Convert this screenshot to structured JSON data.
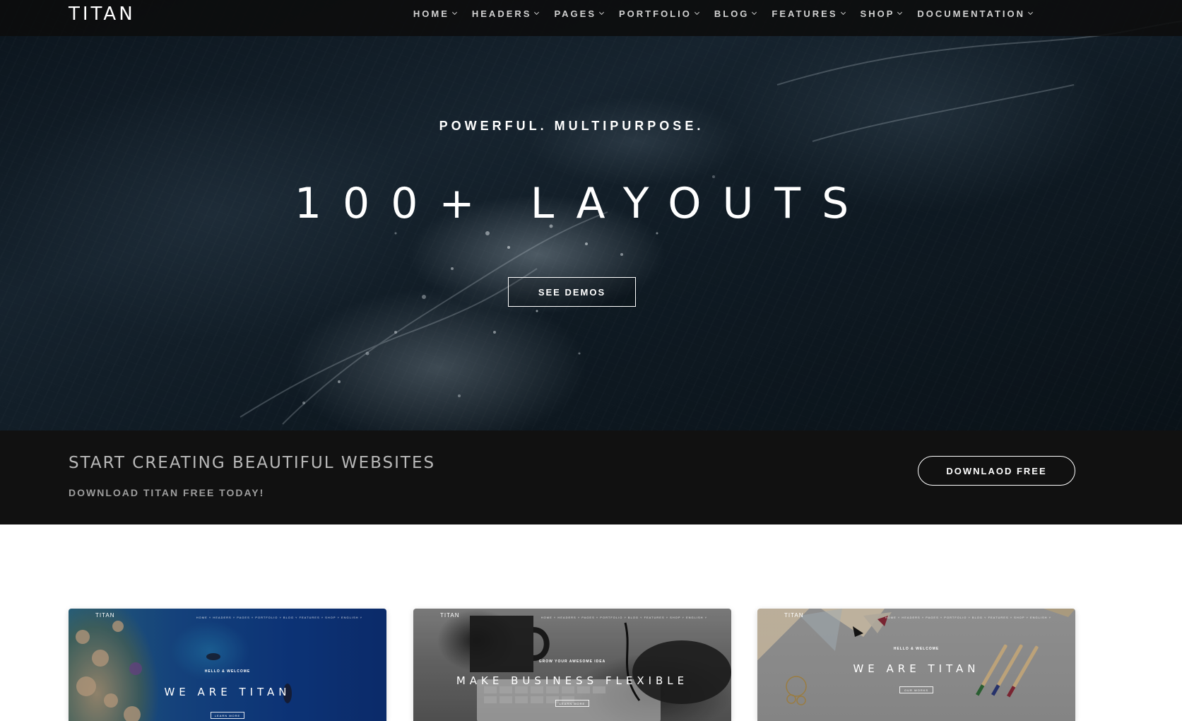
{
  "brand": {
    "name": "TITAN"
  },
  "nav": {
    "items": [
      {
        "label": "HOME"
      },
      {
        "label": "HEADERS"
      },
      {
        "label": "PAGES"
      },
      {
        "label": "PORTFOLIO"
      },
      {
        "label": "BLOG"
      },
      {
        "label": "FEATURES"
      },
      {
        "label": "SHOP"
      },
      {
        "label": "DOCUMENTATION"
      }
    ]
  },
  "hero": {
    "subtitle": "POWERFUL. MULTIPURPOSE.",
    "title": "100+ LAYOUTS",
    "button_label": "SEE DEMOS"
  },
  "cta": {
    "title": "START CREATING BEAUTIFUL WEBSITES",
    "subtitle": "DOWNLOAD TITAN FREE TODAY!",
    "button_label": "DOWNLAOD FREE"
  },
  "demos": [
    {
      "logo": "TITAN",
      "nav": "HOME ˅  HEADERS ˅  PAGES ˅  PORTFOLIO ˅  BLOG ˅  FEATURES ˅  SHOP ˅  ENGLISH ˅",
      "kicker": "HELLO & WELCOME",
      "headline": "WE ARE TITAN",
      "button": "LEARN MORE"
    },
    {
      "logo": "TITAN",
      "nav": "HOME ˅  HEADERS ˅  PAGES ˅  PORTFOLIO ˅  BLOG ˅  FEATURES ˅  SHOP ˅  ENGLISH ˅",
      "kicker": "GROW YOUR AWESOME IDEA",
      "headline": "MAKE BUSINESS FLEXIBLE",
      "button": "LEARN MORE"
    },
    {
      "logo": "TITAN",
      "nav": "HOME ˅  HEADERS ˅  PAGES ˅  PORTFOLIO ˅  BLOG ˅  FEATURES ˅  SHOP ˅  ENGLISH ˅",
      "kicker": "HELLO & WELCOME",
      "headline": "WE ARE TITAN",
      "button": "OUR WORKS"
    }
  ],
  "colors": {
    "navbar_bg": "#0c0c0c",
    "cta_bg": "#111111",
    "page_bg": "#ffffff",
    "text_light": "#ffffff",
    "text_muted": "#b9b9b9"
  },
  "icons": [
    "chevron-down-icon"
  ]
}
